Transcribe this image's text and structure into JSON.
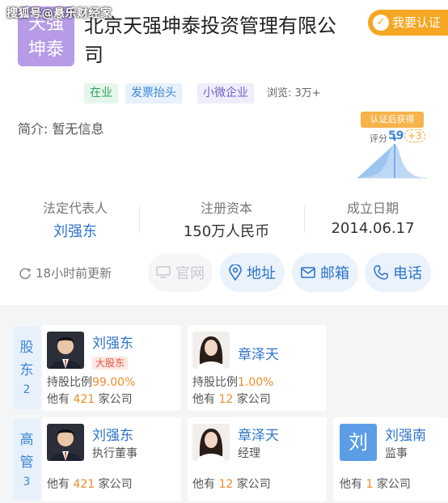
{
  "watermark": "搜狐号@悬乐财经家",
  "logo": {
    "line1": "天强",
    "line2": "坤泰"
  },
  "company": {
    "name": "北京天强坤泰投资管理有限公司"
  },
  "verify_button": "我要认证",
  "tags": {
    "status": "在业",
    "invoice": "发票抬头",
    "size": "小微企业"
  },
  "views": "浏览: 3万+",
  "intro": "简介: 暂无信息",
  "score_badge": {
    "title": "认证后获得",
    "label": "评分",
    "score": "59",
    "plus": "+3"
  },
  "stats": {
    "legal_rep_label": "法定代表人",
    "legal_rep_value": "刘强东",
    "capital_label": "注册资本",
    "capital_value": "150万人民币",
    "founded_label": "成立日期",
    "founded_value": "2014.06.17"
  },
  "update_text": "18小时前更新",
  "actions": {
    "website": "官网",
    "address": "地址",
    "email": "邮箱",
    "phone": "电话"
  },
  "shareholders": {
    "head_chars": [
      "股",
      "东",
      "2"
    ],
    "items": [
      {
        "name": "刘强东",
        "badge": "大股东",
        "ratio_label": "持股比例",
        "ratio": "99.00%",
        "other_pre": "他有",
        "other_num": "421",
        "other_post": "家公司"
      },
      {
        "name": "章泽天",
        "ratio_label": "持股比例",
        "ratio": "1.00%",
        "other_pre": "他有",
        "other_num": "12",
        "other_post": "家公司"
      }
    ]
  },
  "executives": {
    "head_chars": [
      "高",
      "管",
      "3"
    ],
    "items": [
      {
        "name": "刘强东",
        "role": "执行董事",
        "other_pre": "他有",
        "other_num": "421",
        "other_post": "家公司"
      },
      {
        "name": "章泽天",
        "role": "经理",
        "other_pre": "他有",
        "other_num": "12",
        "other_post": "家公司"
      },
      {
        "name": "刘强南",
        "avatar_char": "刘",
        "role": "监事",
        "other_pre": "他有",
        "other_num": "1",
        "other_post": "家公司"
      }
    ]
  }
}
